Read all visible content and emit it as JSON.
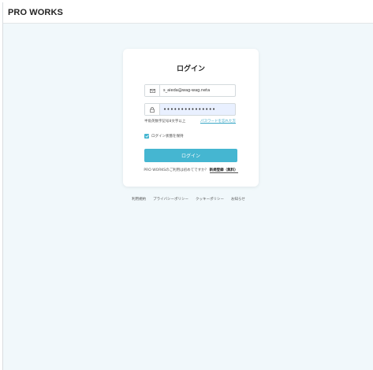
{
  "header": {
    "logo": "PRO WORKS"
  },
  "login": {
    "title": "ログイン",
    "email_icon": "mail-icon",
    "email_value": "s_aieda@wag-wag.neta",
    "password_icon": "lock-icon",
    "password_value": "•••••••••••••••",
    "password_hint": "半角英数字記号8文字以上",
    "forgot_link": "パスワードを忘れた方",
    "keep_login_label": "ログイン状態を保持",
    "keep_login_checked": true,
    "submit_label": "ログイン",
    "signup_prompt": "PRO WORKSのご利用は初めてですか？",
    "signup_link": "新規登録（無料）"
  },
  "footer": {
    "links": [
      "利用規約",
      "プライバシーポリシー",
      "クッキーポリシー",
      "お知らせ"
    ]
  },
  "colors": {
    "accent": "#45b6d1",
    "link": "#3aa7c6",
    "background": "#f1f8fb"
  }
}
